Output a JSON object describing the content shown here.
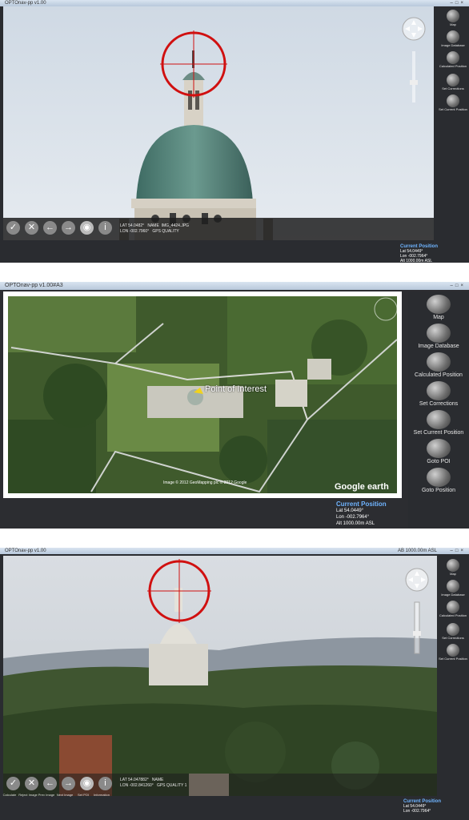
{
  "window": {
    "title_small": "OPTOnav-pp v1.00",
    "title_map": "OPTOnav-pp v1.00#A3",
    "title_small_right": "AB 1000.00m ASL"
  },
  "sidebar_small": [
    {
      "label": "Map"
    },
    {
      "label": "Image Database"
    },
    {
      "label": "Calculated Position"
    },
    {
      "label": "Set Corrections"
    },
    {
      "label": "Set Current Position"
    }
  ],
  "sidebar_map": [
    {
      "label": "Map"
    },
    {
      "label": "Image Database"
    },
    {
      "label": "Calculated Position"
    },
    {
      "label": "Set Corrections"
    },
    {
      "label": "Set Current Position"
    },
    {
      "label": "Goto POI"
    },
    {
      "label": "Goto Position"
    }
  ],
  "toolbar": [
    {
      "label": "Calculate",
      "icon": "check-icon"
    },
    {
      "label": "Reject Image",
      "icon": "x-icon"
    },
    {
      "label": "Prev Image",
      "icon": "arrow-left-icon"
    },
    {
      "label": "Next Image",
      "icon": "arrow-right-icon"
    },
    {
      "label": "Set POI",
      "icon": "target-icon"
    },
    {
      "label": "Information",
      "icon": "info-icon"
    }
  ],
  "panel1_info": {
    "lat": "LAT   54.0482°",
    "lon": "LON  -002.7960°",
    "name": "NAME",
    "file": "IMG_4424.JPG",
    "gps": "GPS QUALITY"
  },
  "panel3_info": {
    "lat": "LAT   54.047882°",
    "lon": "LON  -002.841260°",
    "name": "NAME",
    "gps": "GPS QUALITY  1"
  },
  "current_position": {
    "title": "Current Position",
    "lat": "Lat 54.0449°",
    "lon": "Lon -002.7964°",
    "alt": "Alt 1000.00m ASL"
  },
  "map": {
    "poi_label": "Point of Interest",
    "copyright": "Image © 2012 GeoMapping plc  © 2012 Google",
    "logo": "Google earth"
  },
  "colors": {
    "crosshair": "#d01010",
    "accent": "#5aa9ff",
    "panel_bg": "#2a2c30"
  }
}
